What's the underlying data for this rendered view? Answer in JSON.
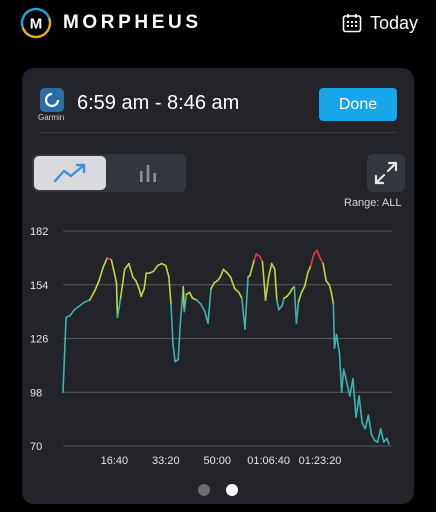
{
  "header": {
    "brand": "MORPHEUS",
    "logo_letter": "M",
    "today_label": "Today",
    "calendar_icon": "calendar-icon"
  },
  "session": {
    "source_label": "Garmin",
    "time_range": "6:59 am - 8:46 am",
    "done_label": "Done"
  },
  "view_toggle": {
    "options": [
      "line-chart-icon",
      "bar-chart-icon"
    ],
    "selected": "line"
  },
  "range_label": "Range: ALL",
  "pagination": {
    "count": 2,
    "active_index": 1
  },
  "colors": {
    "accent": "#16a6e9",
    "zone_red": "#e8384a",
    "zone_yellow": "#c2d73e",
    "zone_teal": "#3fb3ad"
  },
  "chart_data": {
    "type": "line",
    "title": "",
    "xlabel": "",
    "ylabel": "",
    "y_ticks": [
      "182",
      "154",
      "126",
      "98",
      "70"
    ],
    "ylim": [
      70,
      182
    ],
    "x_tick_labels": [
      "16:40",
      "33:20",
      "50:00",
      "01:06:40",
      "01:23:20"
    ],
    "x_tick_values": [
      1000,
      2000,
      3000,
      4000,
      5000
    ],
    "xlim": [
      0,
      6400
    ],
    "grid": true,
    "series": [
      {
        "x": [
          0,
          60,
          140,
          220,
          320,
          420,
          520,
          620,
          700,
          780,
          860,
          940,
          1000,
          1040,
          1060,
          1120,
          1200,
          1280,
          1360,
          1420,
          1480,
          1520,
          1580,
          1620,
          1680,
          1760,
          1840,
          1920,
          2000,
          2060,
          2100,
          2140,
          2180,
          2240,
          2280,
          2340,
          2360,
          2400,
          2460,
          2520,
          2600,
          2680,
          2760,
          2820,
          2880,
          2940,
          3000,
          3060,
          3120,
          3200,
          3260,
          3340,
          3420,
          3480,
          3540,
          3600,
          3640,
          3680,
          3720,
          3760,
          3820,
          3880,
          3940,
          4000,
          4060,
          4120,
          4160,
          4200,
          4260,
          4300,
          4360,
          4420,
          4460,
          4500,
          4540,
          4580,
          4640,
          4700,
          4760,
          4820,
          4880,
          4940,
          5000,
          5060,
          5120,
          5180,
          5220,
          5260,
          5280,
          5320,
          5380,
          5420,
          5460,
          5520,
          5580,
          5640,
          5700,
          5760,
          5820,
          5880,
          5940,
          6000,
          6060,
          6120,
          6180,
          6240,
          6300,
          6340
        ],
        "y": [
          98,
          137,
          138,
          141,
          143,
          145,
          146,
          151,
          156,
          163,
          168,
          167,
          160,
          155,
          137,
          147,
          162,
          165,
          158,
          156,
          152,
          148,
          152,
          160,
          160,
          161,
          164,
          165,
          164,
          158,
          144,
          123,
          114,
          115,
          133,
          153,
          140,
          149,
          150,
          147,
          146,
          144,
          140,
          134,
          152,
          155,
          156,
          158,
          162,
          160,
          158,
          152,
          150,
          147,
          131,
          158,
          159,
          163,
          167,
          170,
          169,
          166,
          146,
          158,
          165,
          162,
          146,
          141,
          143,
          147,
          148,
          150,
          152,
          153,
          134,
          145,
          150,
          153,
          160,
          164,
          170,
          172,
          168,
          165,
          156,
          154,
          150,
          144,
          121,
          128,
          118,
          98,
          110,
          103,
          96,
          105,
          85,
          96,
          82,
          79,
          86,
          76,
          73,
          72,
          79,
          72,
          74,
          71
        ]
      }
    ]
  }
}
